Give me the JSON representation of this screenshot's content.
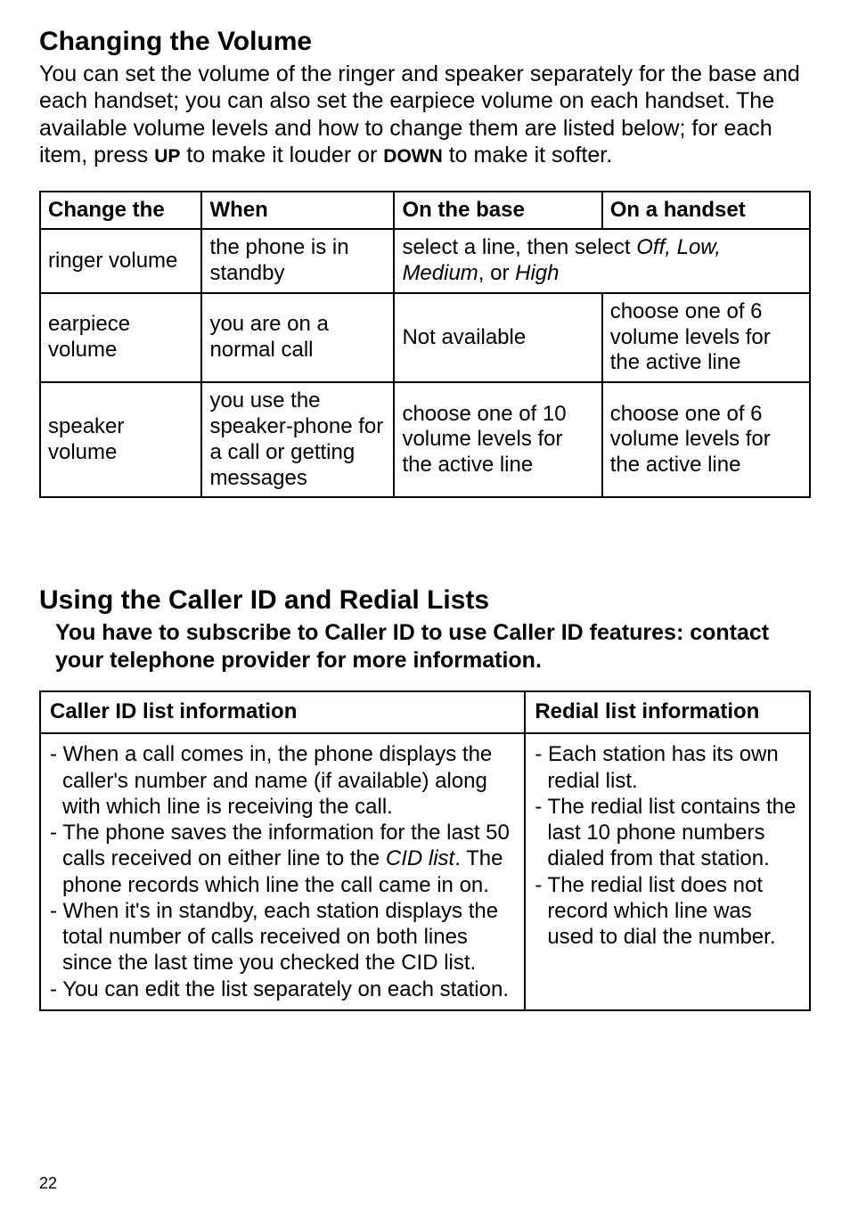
{
  "section1": {
    "title": "Changing the Volume",
    "intro_part1": "You can set the volume of the ringer and speaker separately for the base and each handset; you can also set the earpiece volume on each handset. The available volume levels and how to change them are listed below; for each item, press ",
    "intro_up": "UP",
    "intro_part2": " to make it louder or ",
    "intro_down": "DOWN",
    "intro_part3": " to make it softer."
  },
  "table1": {
    "headers": [
      "Change the",
      "When",
      "On the base",
      "On a handset"
    ],
    "rows": [
      {
        "c0": "ringer volume",
        "c1": "the phone is in standby",
        "c2_pre": "select a line, then select ",
        "c2_em1": "Off, Low, Medium",
        "c2_mid": ", or ",
        "c2_em2": "High"
      },
      {
        "c0": "earpiece volume",
        "c1": "you are on a normal call",
        "c2": "Not available",
        "c3": "choose one of 6 volume levels for the active line"
      },
      {
        "c0": "speaker volume",
        "c1": "you use the speaker-phone for a call or getting messages",
        "c2": "choose one of 10 volume levels for the active line",
        "c3": "choose one of 6 volume levels for the active line"
      }
    ]
  },
  "section2": {
    "title": "Using the Caller ID and Redial Lists",
    "sub": "You have to subscribe to Caller ID to use Caller ID features: contact your telephone provider for more information."
  },
  "table2": {
    "headers": [
      "Caller ID list information",
      "Redial list information"
    ],
    "col1": {
      "l1": "- When a call comes in, the phone displays the caller's number and name (if available) along with which line is receiving the call.",
      "l2a": "- The phone saves the information for the last 50 calls received on either line to the ",
      "l2em": "CID list",
      "l2b": ". The phone records which line the call came in on.",
      "l3": "- When it's in standby, each station displays the total number of calls received on both lines since the last time you checked the CID list.",
      "l4": "- You can edit the list separately on each station."
    },
    "col2": {
      "l1": "- Each station has its own redial list.",
      "l2": "- The redial list contains the last 10 phone numbers dialed from that station.",
      "l3": "- The redial list does not record which line was used to dial the number."
    }
  },
  "page_number": "22"
}
